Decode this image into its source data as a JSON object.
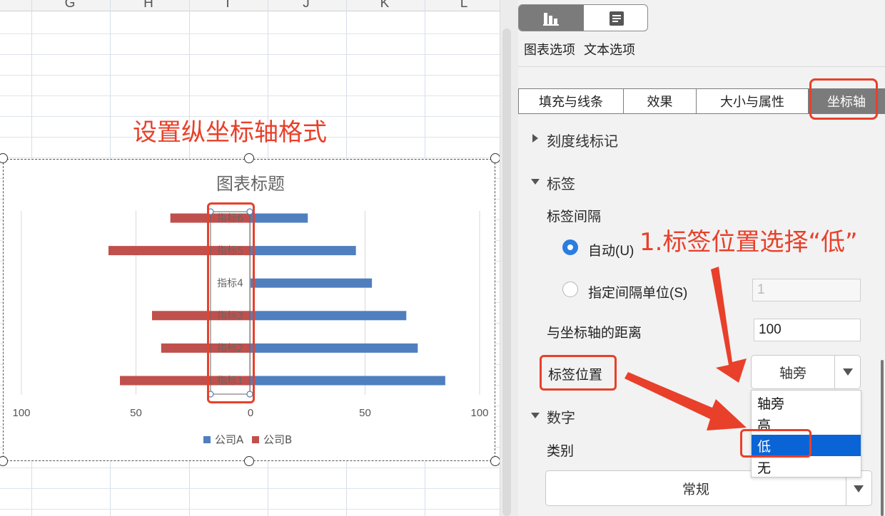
{
  "sheet": {
    "columns": [
      "G",
      "H",
      "I",
      "J",
      "K",
      "L"
    ]
  },
  "annotations": {
    "heading": "设置纵坐标轴格式",
    "step1": "1.标签位置选择“低”"
  },
  "chart_data": {
    "type": "bar",
    "orientation": "horizontal",
    "title": "图表标题",
    "categories": [
      "指标1",
      "指标2",
      "指标3",
      "指标4",
      "指标5",
      "指标6"
    ],
    "series": [
      {
        "name": "公司A",
        "values": [
          85,
          73,
          68,
          53,
          46,
          25
        ],
        "color": "#4f7fbf"
      },
      {
        "name": "公司B",
        "values": [
          57,
          39,
          43,
          0,
          62,
          35
        ],
        "color": "#c0504d"
      }
    ],
    "x_ticks": [
      "100",
      "50",
      "0",
      "50",
      "100"
    ],
    "xlim": [
      -100,
      100
    ],
    "grid": true,
    "legend": "bottom"
  },
  "panel": {
    "tab_labels": [
      "图表选项",
      "文本选项"
    ],
    "segments": [
      "填充与线条",
      "效果",
      "大小与属性",
      "坐标轴"
    ],
    "sections": {
      "tick_marks": "刻度线标记",
      "labels": "标签",
      "number": "数字"
    },
    "label_interval": {
      "title": "标签间隔",
      "auto": "自动(U)",
      "specify": "指定间隔单位(S)",
      "specify_value": "1"
    },
    "distance": {
      "label": "与坐标轴的距离",
      "value": "100"
    },
    "label_position": {
      "label": "标签位置",
      "value": "轴旁",
      "options": [
        "轴旁",
        "高",
        "低",
        "无"
      ],
      "highlighted": "低"
    },
    "category": {
      "label": "类别",
      "value": "常规"
    }
  },
  "colors": {
    "annotation": "#e8402a",
    "series_a": "#4f7fbf",
    "series_b": "#c0504d",
    "selection_blue": "#0a64d6"
  }
}
